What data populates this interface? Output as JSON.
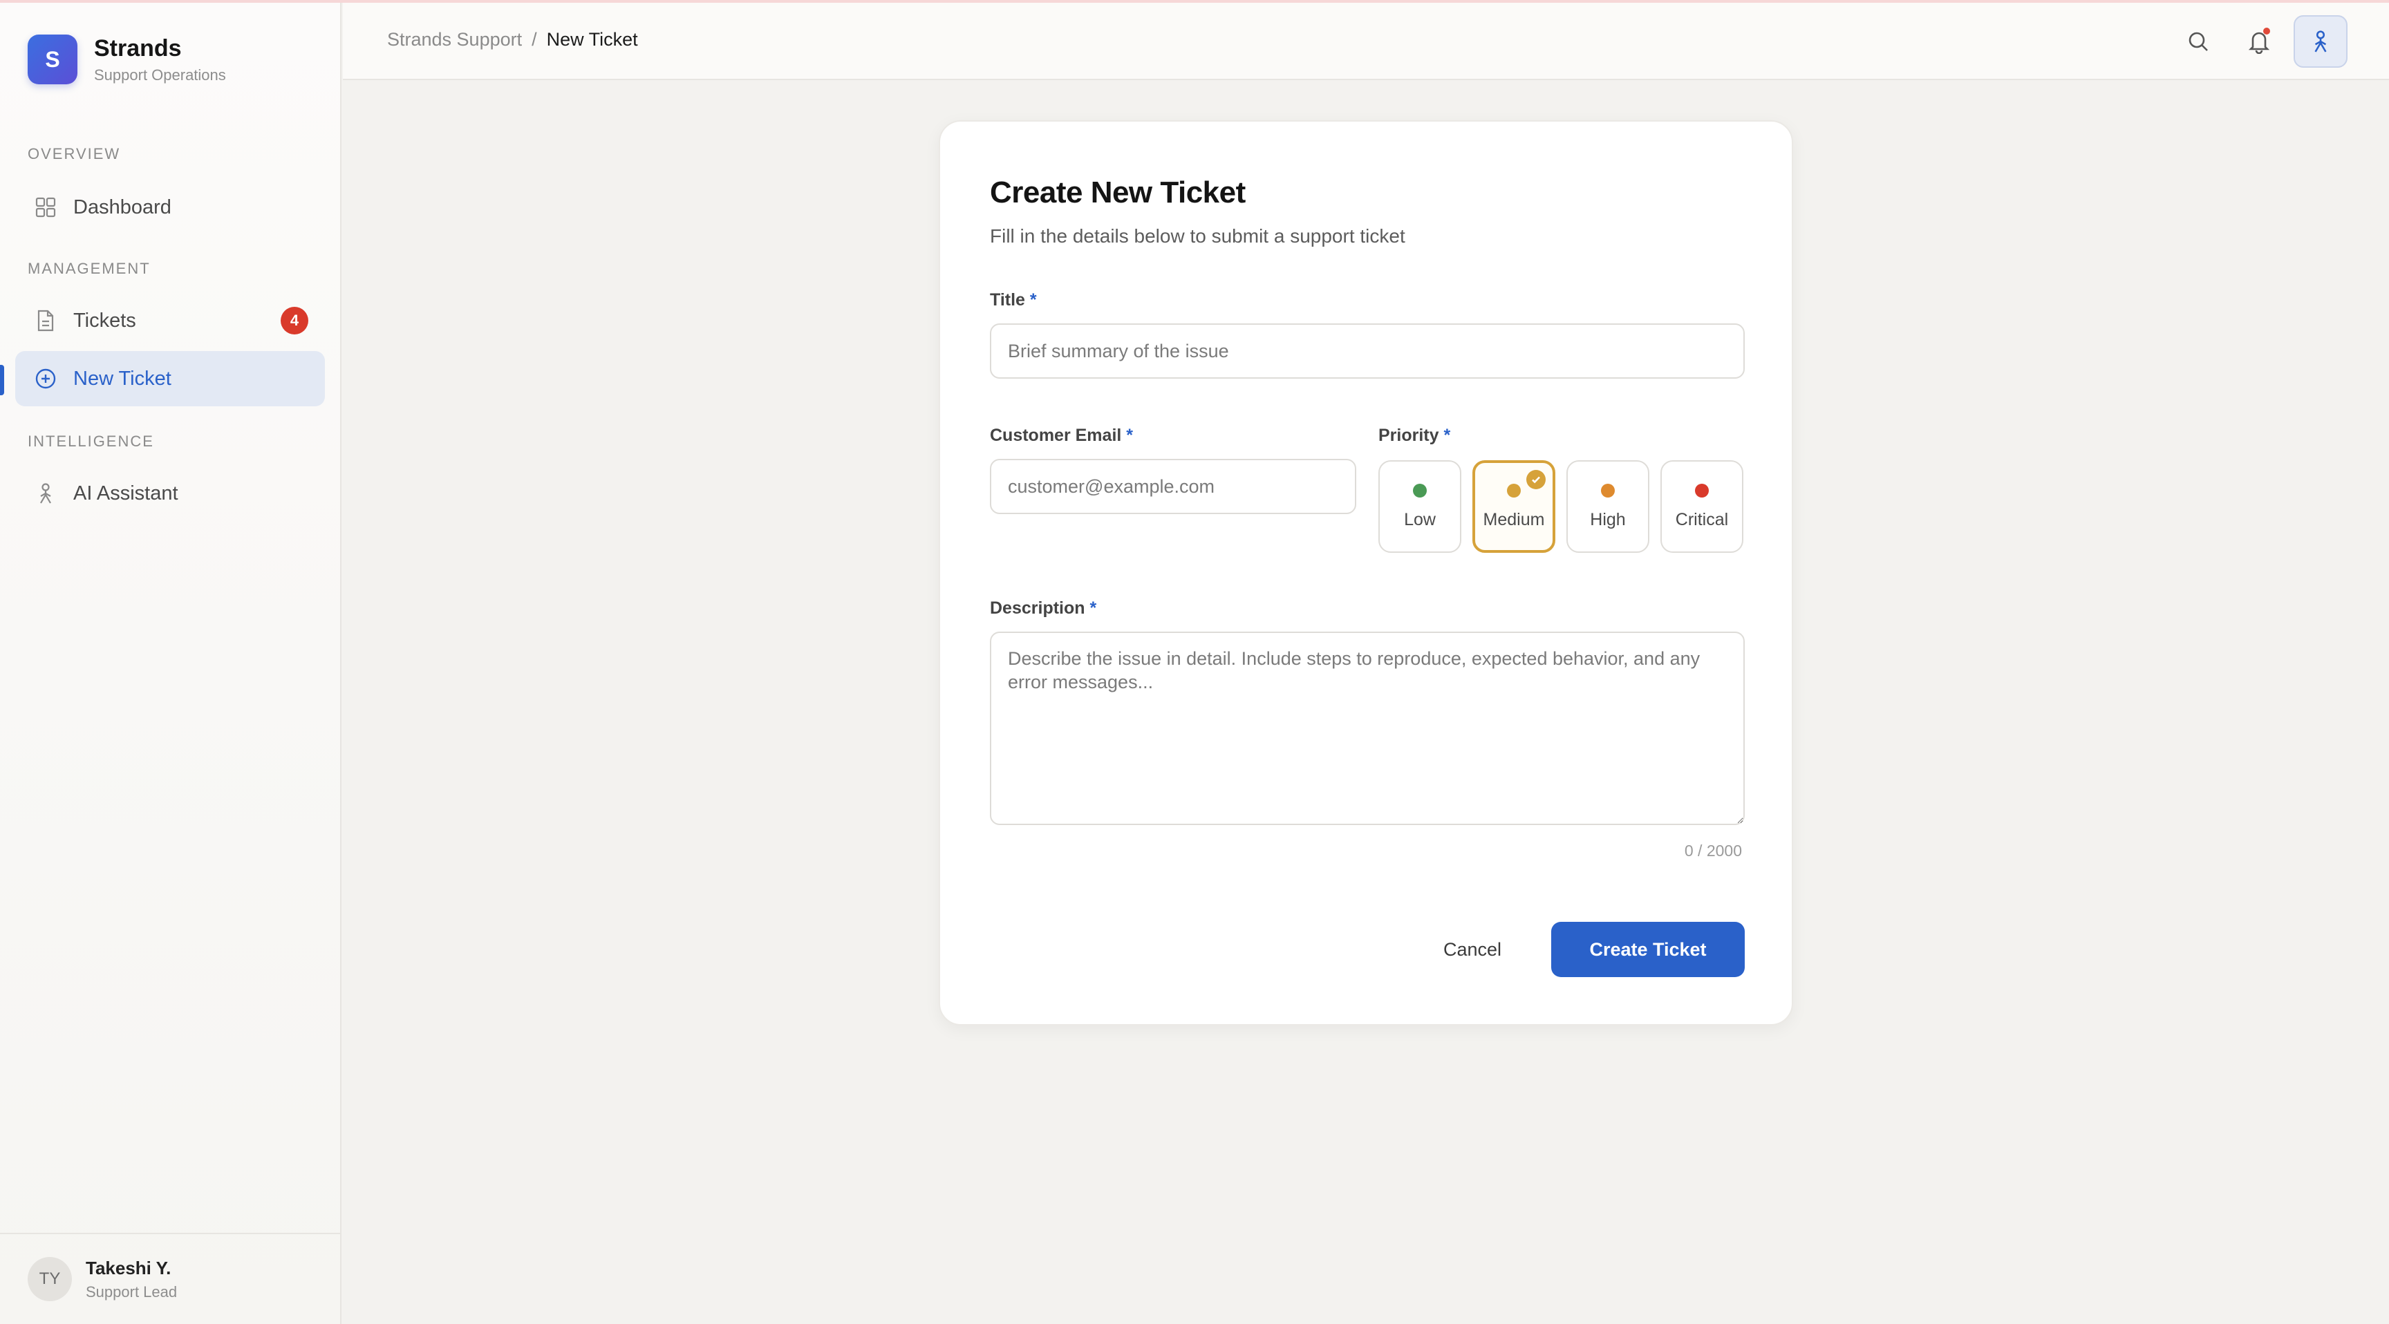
{
  "brand": {
    "logo_letter": "S",
    "name": "Strands",
    "subtitle": "Support Operations",
    "accent": "#2a61c9"
  },
  "sidebar": {
    "sections": [
      {
        "label": "OVERVIEW"
      },
      {
        "label": "MANAGEMENT"
      },
      {
        "label": "INTELLIGENCE"
      }
    ],
    "items": [
      {
        "label": "Dashboard",
        "icon": "grid-icon"
      },
      {
        "label": "Tickets",
        "icon": "document-icon",
        "badge": "4"
      },
      {
        "label": "New Ticket",
        "icon": "plus-circle-icon",
        "active": true
      },
      {
        "label": "AI Assistant",
        "icon": "person-icon"
      }
    ],
    "user": {
      "initials": "TY",
      "name": "Takeshi Y.",
      "role": "Support Lead"
    }
  },
  "header": {
    "breadcrumb": [
      "Strands Support",
      "New Ticket"
    ],
    "separator": "/",
    "icons": [
      "search-icon",
      "bell-icon",
      "assistant-icon"
    ]
  },
  "form": {
    "title": "Create New Ticket",
    "subtitle": "Fill in the details below to submit a support ticket",
    "required_mark": "*",
    "title_field": {
      "label": "Title",
      "placeholder": "Brief summary of the issue",
      "value": ""
    },
    "email_field": {
      "label": "Customer Email",
      "placeholder": "customer@example.com",
      "value": ""
    },
    "priority": {
      "label": "Priority",
      "selected": "Medium",
      "options": [
        {
          "label": "Low",
          "color": "#4a9a55"
        },
        {
          "label": "Medium",
          "color": "#d6a23a"
        },
        {
          "label": "High",
          "color": "#de8a2e"
        },
        {
          "label": "Critical",
          "color": "#d93a2b"
        }
      ]
    },
    "description": {
      "label": "Description",
      "placeholder": "Describe the issue in detail. Include steps to reproduce, expected behavior, and any error messages...",
      "value": "",
      "counter": "0 / 2000"
    },
    "cancel_label": "Cancel",
    "submit_label": "Create Ticket"
  }
}
